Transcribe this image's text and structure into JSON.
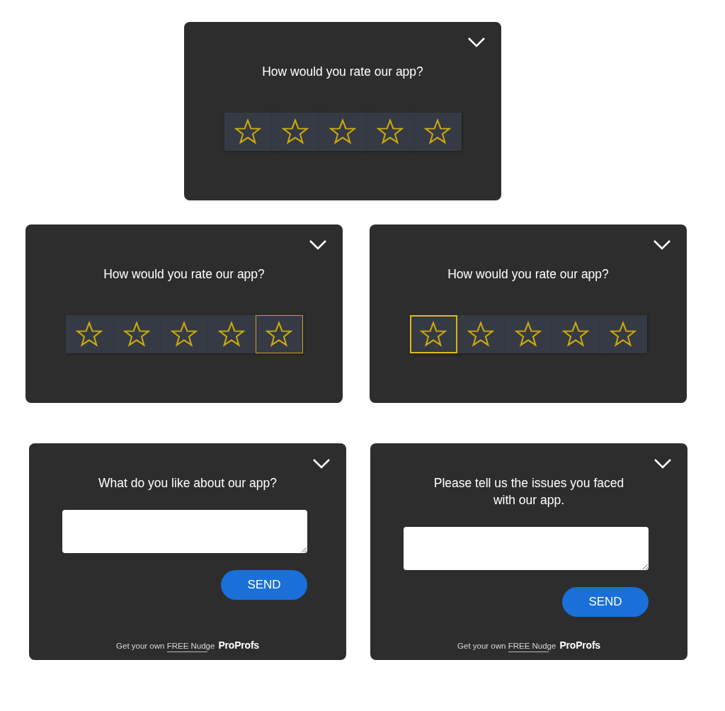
{
  "rows": [
    {
      "cards": [
        {
          "kind": "rating",
          "question": "How would you rate our app?",
          "stars": [
            {
              "selected": false
            },
            {
              "selected": false
            },
            {
              "selected": false
            },
            {
              "selected": false
            },
            {
              "selected": false
            }
          ]
        }
      ]
    },
    {
      "cards": [
        {
          "kind": "rating",
          "question": "How would you rate our app?",
          "stars": [
            {
              "selected": false
            },
            {
              "selected": false
            },
            {
              "selected": false
            },
            {
              "selected": false
            },
            {
              "selected": true
            }
          ]
        },
        {
          "kind": "rating",
          "question": "How would you rate our app?",
          "stars": [
            {
              "selected": true
            },
            {
              "selected": false
            },
            {
              "selected": false
            },
            {
              "selected": false
            },
            {
              "selected": false
            }
          ]
        }
      ]
    },
    {
      "cards": [
        {
          "kind": "text",
          "question": "What do you like about our app?",
          "button": "SEND",
          "footer": {
            "link": "Get your own FREE Nudge",
            "brand": "ProProfs"
          }
        },
        {
          "kind": "text",
          "question": "Please tell us the issues you faced with our app.",
          "button": "SEND",
          "footer": {
            "link": "Get your own FREE Nudge",
            "brand": "ProProfs"
          }
        }
      ]
    }
  ]
}
